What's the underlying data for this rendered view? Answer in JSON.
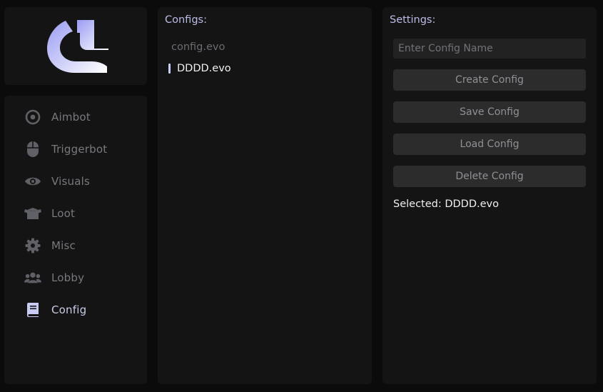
{
  "brand": {
    "logo": "logo-icon",
    "logo_gradient": [
      "#9a9cf2",
      "#ffffff"
    ]
  },
  "sidebar": {
    "items": [
      {
        "label": "Aimbot",
        "icon": "target-icon",
        "active": false
      },
      {
        "label": "Triggerbot",
        "icon": "mouse-icon",
        "active": false
      },
      {
        "label": "Visuals",
        "icon": "eye-icon",
        "active": false
      },
      {
        "label": "Loot",
        "icon": "box-icon",
        "active": false
      },
      {
        "label": "Misc",
        "icon": "gear-icon",
        "active": false
      },
      {
        "label": "Lobby",
        "icon": "users-icon",
        "active": false
      },
      {
        "label": "Config",
        "icon": "book-icon",
        "active": true
      }
    ]
  },
  "configs": {
    "title": "Configs:",
    "items": [
      {
        "name": "config.evo",
        "selected": false
      },
      {
        "name": "DDDD.evo",
        "selected": true
      }
    ]
  },
  "settings": {
    "title": "Settings:",
    "name_input": {
      "placeholder": "Enter Config Name",
      "value": ""
    },
    "buttons": {
      "create": "Create Config",
      "save": "Save Config",
      "load": "Load Config",
      "delete": "Delete Config"
    },
    "selected_label": "Selected: DDDD.evo"
  },
  "colors": {
    "accent": "#c9ccf2",
    "panel_bg": "#141414",
    "window_bg": "#0b0b0b",
    "icon_muted": "#5f6166",
    "icon_active": "#c9ccf2"
  }
}
